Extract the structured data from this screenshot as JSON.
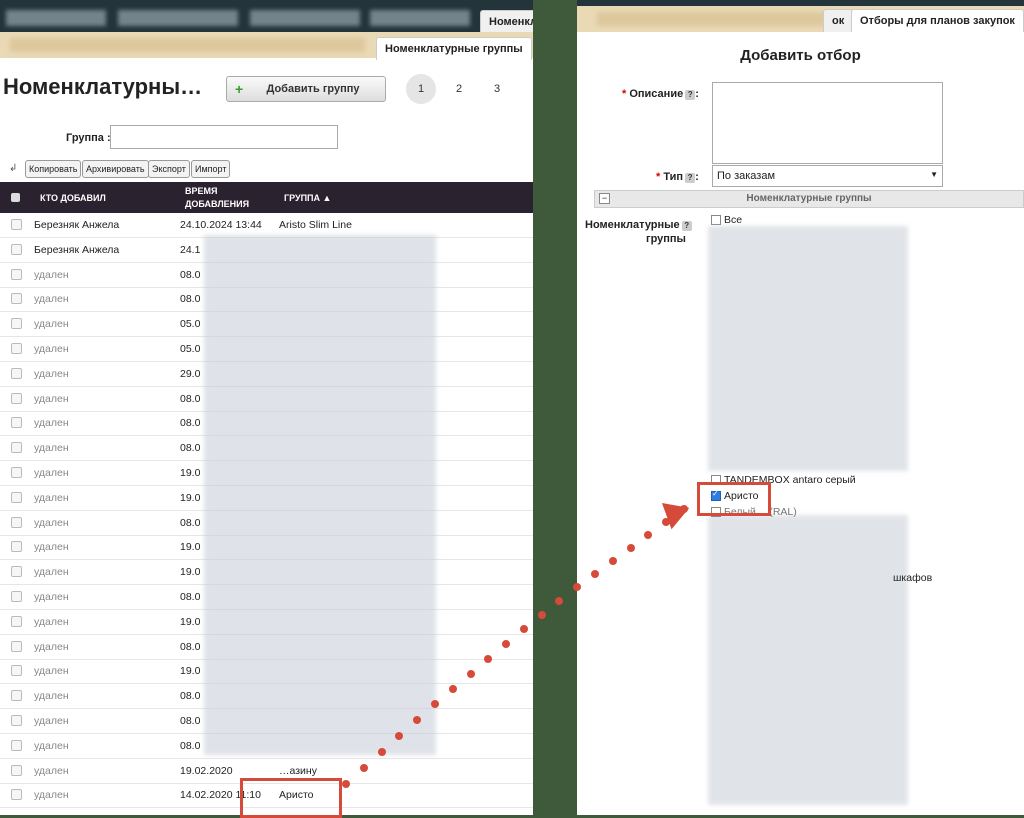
{
  "left": {
    "tab_nomenclature": "Номенклатурные",
    "subtab_active": "Номенклатурные группы",
    "page_title": "Номенклатурны…",
    "add_group_button": "Добавить группу",
    "pages": [
      "1",
      "2",
      "3"
    ],
    "filter_label": "Группа :",
    "toolbar": [
      "Копировать",
      "Архивировать",
      "Экспорт",
      "Импорт"
    ],
    "headers": {
      "who": "КТО ДОБАВИЛ",
      "time": "ВРЕМЯ ДОБАВЛЕНИЯ",
      "group": "ГРУППА ▲"
    },
    "rows": [
      {
        "who": "Березняк Анжела",
        "time": "24.10.2024 13:44",
        "group": "Aristo Slim Line"
      },
      {
        "who": "Березняк Анжела",
        "time": "24.1",
        "group": ""
      },
      {
        "who": "удален",
        "time": "08.0",
        "group": ""
      },
      {
        "who": "удален",
        "time": "08.0",
        "group": ""
      },
      {
        "who": "удален",
        "time": "05.0",
        "group": ""
      },
      {
        "who": "удален",
        "time": "05.0",
        "group": ""
      },
      {
        "who": "удален",
        "time": "29.0",
        "group": ""
      },
      {
        "who": "удален",
        "time": "08.0",
        "group": ""
      },
      {
        "who": "удален",
        "time": "08.0",
        "group": ""
      },
      {
        "who": "удален",
        "time": "08.0",
        "group": ""
      },
      {
        "who": "удален",
        "time": "19.0",
        "group": ""
      },
      {
        "who": "удален",
        "time": "19.0",
        "group": ""
      },
      {
        "who": "удален",
        "time": "08.0",
        "group": ""
      },
      {
        "who": "удален",
        "time": "19.0",
        "group": ""
      },
      {
        "who": "удален",
        "time": "19.0",
        "group": ""
      },
      {
        "who": "удален",
        "time": "08.0",
        "group": ""
      },
      {
        "who": "удален",
        "time": "19.0",
        "group": ""
      },
      {
        "who": "удален",
        "time": "08.0",
        "group": ""
      },
      {
        "who": "удален",
        "time": "19.0",
        "group": ""
      },
      {
        "who": "удален",
        "time": "08.0",
        "group": ""
      },
      {
        "who": "удален",
        "time": "08.0",
        "group": ""
      },
      {
        "who": "удален",
        "time": "08.0",
        "group": ""
      },
      {
        "who": "удален",
        "time": "19.02.2020",
        "group": "…азину"
      },
      {
        "who": "удален",
        "time": "14.02.2020 11:10",
        "group": "Аристо"
      }
    ]
  },
  "right": {
    "tab_partial": "ок",
    "tab_active": "Отборы для планов закупок",
    "form_title": "Добавить отбор",
    "description_label": "Описание",
    "type_label": "Тип",
    "type_value": "По заказам",
    "section_title": "Номенклатурные группы",
    "groups_label_1": "Номенклатурные",
    "groups_label_2": "группы",
    "all_label": "Все",
    "item_tandembox": "TANDEMBOX antaro серый",
    "item_aristo": "Аристо",
    "item_partial": "Белый …(RAL)",
    "item_shkafov": "шкафов",
    "help_glyph": "?",
    "required_mark": "*"
  }
}
